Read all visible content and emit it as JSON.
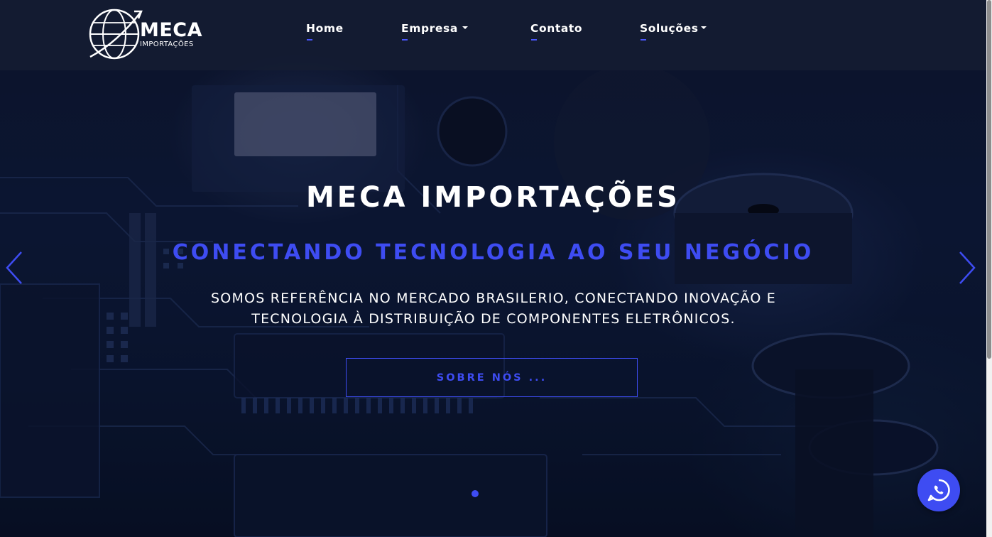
{
  "brand": {
    "name": "MECA",
    "tagline": "IMPORTAÇÕES"
  },
  "nav": {
    "items": [
      {
        "label": "Home",
        "has_dropdown": false
      },
      {
        "label": "Empresa",
        "has_dropdown": true
      },
      {
        "label": "Contato",
        "has_dropdown": false
      },
      {
        "label": "Soluções",
        "has_dropdown": true
      }
    ]
  },
  "hero": {
    "title": "MECA IMPORTAÇÕES",
    "subtitle": "CONECTANDO TECNOLOGIA AO SEU NEGÓCIO",
    "lead_line1": "SOMOS REFERÊNCIA NO MERCADO BRASILERIO, CONECTANDO INOVAÇÃO E",
    "lead_line2": "TECNOLOGIA À DISTRIBUIÇÃO DE COMPONENTES ELETRÔNICOS.",
    "cta_label": "SOBRE NÓS ..."
  },
  "carousel": {
    "prev_icon": "chevron-left-icon",
    "next_icon": "chevron-right-icon",
    "slide_count": 1,
    "active_slide": 1
  },
  "floating": {
    "icon": "whatsapp-icon"
  },
  "colors": {
    "accent": "#3e4cf2",
    "navbar_bg": "#141c32",
    "text": "#ffffff"
  }
}
